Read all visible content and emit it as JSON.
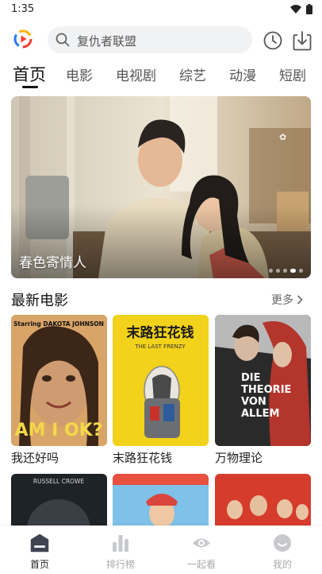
{
  "status": {
    "time": "1:35"
  },
  "search": {
    "placeholder": "复仇者联盟"
  },
  "tabs": [
    "首页",
    "电影",
    "电视剧",
    "综艺",
    "动漫",
    "短剧"
  ],
  "banner": {
    "title": "春色寄情人",
    "dot_count": 5,
    "active_dot": 3
  },
  "section": {
    "title": "最新电影",
    "more": "更多"
  },
  "posters": [
    {
      "title": "我还好吗",
      "lines": [
        "Starring DAKOTA JOHNSON",
        "AM I OK?"
      ]
    },
    {
      "title": "末路狂花钱",
      "lines": [
        "末路狂花钱",
        "THE LAST FRENZY"
      ]
    },
    {
      "title": "万物理论",
      "lines": [
        "DIE",
        "THEORIE",
        "VON",
        "ALLEM"
      ]
    }
  ],
  "posters_row2": [
    {
      "lines": [
        "RUSSELL CROWE"
      ]
    },
    {
      "lines": []
    },
    {
      "lines": []
    }
  ],
  "bottom_nav": [
    {
      "label": "首页",
      "icon": "home-icon",
      "active": true
    },
    {
      "label": "排行榜",
      "icon": "ranking-icon",
      "active": false
    },
    {
      "label": "一起看",
      "icon": "eye-icon",
      "active": false
    },
    {
      "label": "我的",
      "icon": "profile-icon",
      "active": false
    }
  ],
  "colors": {
    "accent": "#111111",
    "logo_red": "#ff3b30",
    "logo_blue": "#2a7bf6",
    "logo_orange": "#ffb300"
  }
}
